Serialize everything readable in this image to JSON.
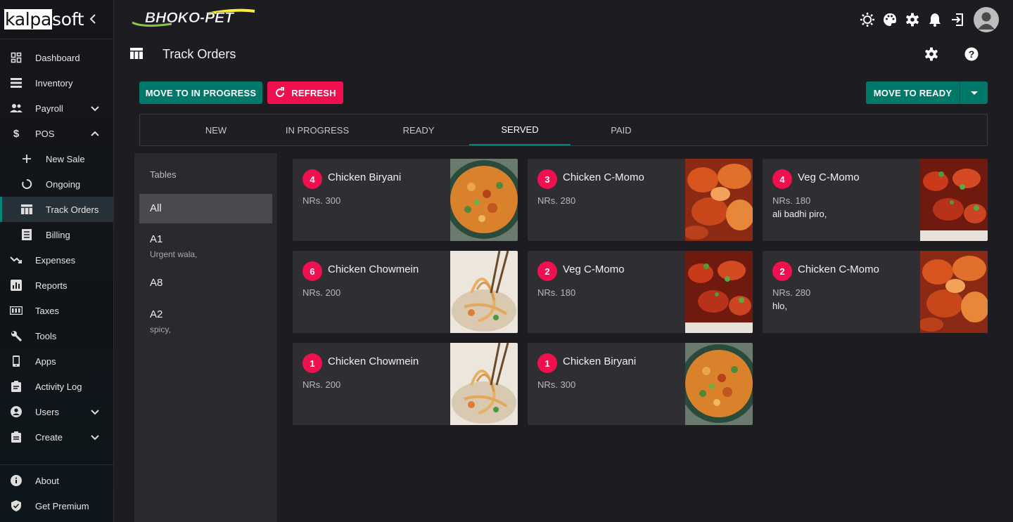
{
  "brand": {
    "logo_box": "kalpa",
    "logo_rest": "soft"
  },
  "app_logo": "BHOKO-PET",
  "sidebar": {
    "items": [
      {
        "label": "Dashboard",
        "icon": "dashboard-icon"
      },
      {
        "label": "Inventory",
        "icon": "inventory-icon"
      },
      {
        "label": "Payroll",
        "icon": "payroll-icon",
        "expanded": false
      },
      {
        "label": "POS",
        "icon": "dollar-icon",
        "expanded": true
      },
      {
        "label": "New Sale",
        "icon": "plus-icon",
        "sub": true
      },
      {
        "label": "Ongoing",
        "icon": "progress-icon",
        "sub": true
      },
      {
        "label": "Track Orders",
        "icon": "table-icon",
        "sub": true,
        "active": true
      },
      {
        "label": "Billing",
        "icon": "billing-icon",
        "sub": true
      },
      {
        "label": "Expenses",
        "icon": "trend-down-icon"
      },
      {
        "label": "Reports",
        "icon": "reports-icon"
      },
      {
        "label": "Taxes",
        "icon": "taxes-icon"
      },
      {
        "label": "Tools",
        "icon": "wrench-icon"
      },
      {
        "label": "Apps",
        "icon": "phone-icon"
      },
      {
        "label": "Activity Log",
        "icon": "clipboard-icon"
      },
      {
        "label": "Users",
        "icon": "user-icon",
        "expanded": false
      },
      {
        "label": "Create",
        "icon": "create-icon",
        "expanded": false
      }
    ],
    "bottom": [
      {
        "label": "About",
        "icon": "info-icon"
      },
      {
        "label": "Get Premium",
        "icon": "shield-check-icon"
      }
    ]
  },
  "page": {
    "title": "Track Orders"
  },
  "actions": {
    "move_in_progress": "MOVE TO IN PROGRESS",
    "refresh": "REFRESH",
    "move_ready": "MOVE TO READY"
  },
  "tabs": [
    {
      "label": "NEW"
    },
    {
      "label": "IN PROGRESS"
    },
    {
      "label": "READY"
    },
    {
      "label": "SERVED",
      "active": true
    },
    {
      "label": "PAID"
    }
  ],
  "tables": {
    "header": "Tables",
    "items": [
      {
        "name": "All",
        "note": "",
        "active": true
      },
      {
        "name": "A1",
        "note": "Urgent wala,"
      },
      {
        "name": "A8",
        "note": ""
      },
      {
        "name": "A2",
        "note": "spicy,"
      }
    ]
  },
  "orders": [
    {
      "qty": "4",
      "name": "Chicken Biryani",
      "price": "NRs. 300",
      "note": "",
      "image": "biryani"
    },
    {
      "qty": "3",
      "name": "Chicken C-Momo",
      "price": "NRs. 280",
      "note": "",
      "image": "cmomo"
    },
    {
      "qty": "4",
      "name": "Veg C-Momo",
      "price": "NRs. 180",
      "note": "ali badhi piro,",
      "image": "vegmomo"
    },
    {
      "qty": "6",
      "name": "Chicken Chowmein",
      "price": "NRs. 200",
      "note": "",
      "image": "chowmein"
    },
    {
      "qty": "2",
      "name": "Veg C-Momo",
      "price": "NRs. 180",
      "note": "",
      "image": "vegmomo"
    },
    {
      "qty": "2",
      "name": "Chicken C-Momo",
      "price": "NRs. 280",
      "note": "hlo,",
      "image": "cmomo"
    },
    {
      "qty": "1",
      "name": "Chicken Chowmein",
      "price": "NRs. 200",
      "note": "",
      "image": "chowmein"
    },
    {
      "qty": "1",
      "name": "Chicken Biryani",
      "price": "NRs. 300",
      "note": "",
      "image": "biryani"
    }
  ],
  "colors": {
    "accent": "#00796b",
    "danger": "#f0104f",
    "background": "#1d1c21"
  }
}
